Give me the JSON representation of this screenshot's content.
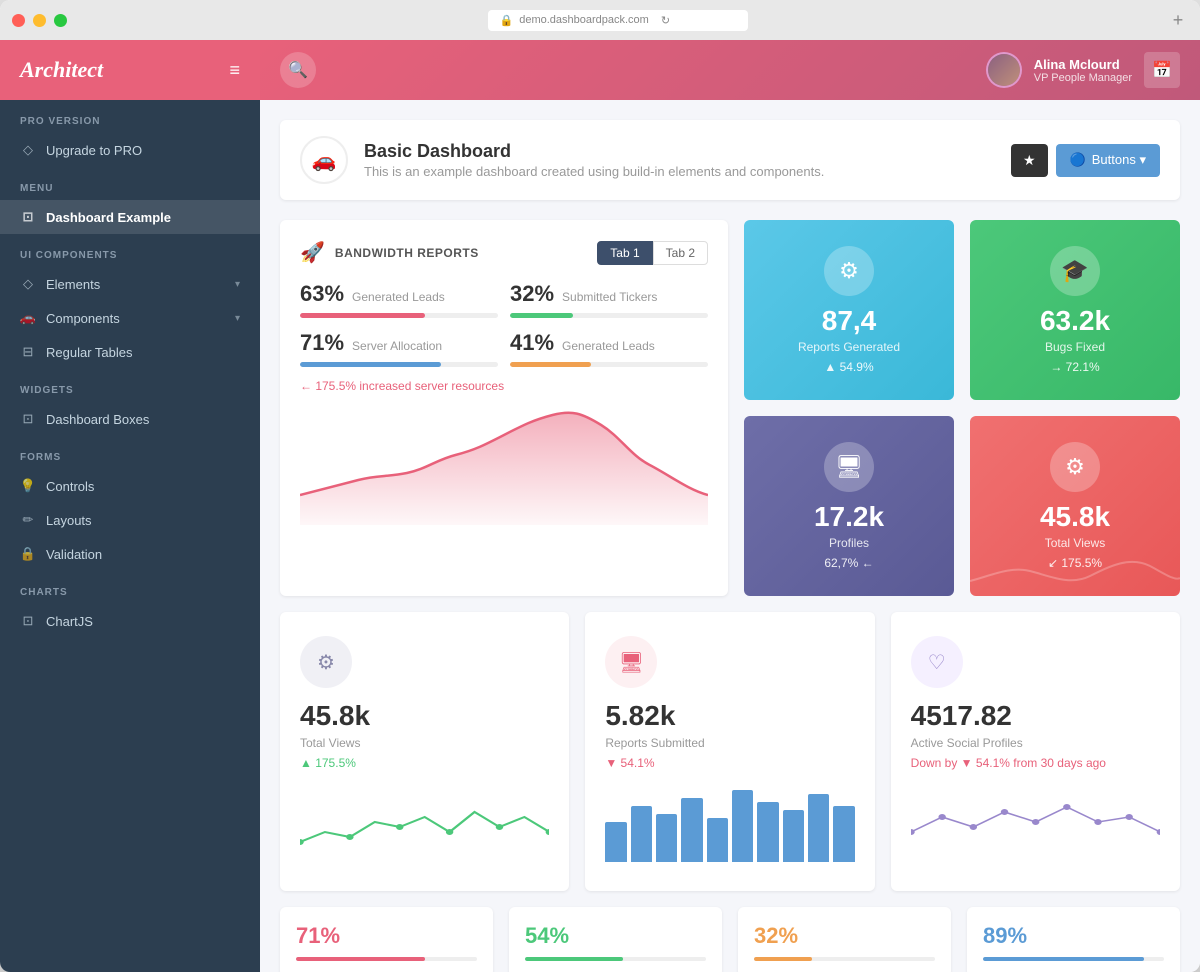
{
  "window": {
    "url": "demo.dashboardpack.com"
  },
  "brand": {
    "name": "Architect",
    "hamburger": "≡"
  },
  "topnav": {
    "search_icon": "🔍",
    "user": {
      "name": "Alina Mclourd",
      "role": "VP People Manager"
    },
    "calendar_icon": "📅"
  },
  "page_header": {
    "icon": "🚗",
    "title": "Basic Dashboard",
    "subtitle": "This is an example dashboard created using build-in elements and components.",
    "star_label": "★",
    "buttons_label": "Buttons ▾"
  },
  "sidebar": {
    "pro_section": "PRO VERSION",
    "upgrade_label": "Upgrade to PRO",
    "menu_section": "MENU",
    "menu_items": [
      {
        "label": "Dashboard Example",
        "icon": "⊡",
        "active": true
      }
    ],
    "ui_section": "UI COMPONENTS",
    "ui_items": [
      {
        "label": "Elements",
        "icon": "◇",
        "has_chevron": true
      },
      {
        "label": "Components",
        "icon": "🚗",
        "has_chevron": true
      },
      {
        "label": "Regular Tables",
        "icon": "⊟",
        "has_chevron": false
      }
    ],
    "widgets_section": "WIDGETS",
    "widgets_items": [
      {
        "label": "Dashboard Boxes",
        "icon": "⊡",
        "has_chevron": false
      }
    ],
    "forms_section": "FORMS",
    "forms_items": [
      {
        "label": "Controls",
        "icon": "💡",
        "has_chevron": false
      },
      {
        "label": "Layouts",
        "icon": "✏️",
        "has_chevron": false
      },
      {
        "label": "Validation",
        "icon": "🔒",
        "has_chevron": false
      }
    ],
    "charts_section": "CHARTS",
    "charts_items": [
      {
        "label": "ChartJS",
        "icon": "⊡",
        "has_chevron": false
      }
    ]
  },
  "bandwidth": {
    "icon": "🚀",
    "title": "BANDWIDTH REPORTS",
    "tab1": "Tab 1",
    "tab2": "Tab 2",
    "stats": [
      {
        "pct": "63%",
        "label": "Generated Leads",
        "fill": "#e8617a",
        "width": "63"
      },
      {
        "pct": "32%",
        "label": "Submitted Tickers",
        "fill": "#4cc87a",
        "width": "32"
      },
      {
        "pct": "71%",
        "label": "Server Allocation",
        "fill": "#5b9bd5",
        "width": "71"
      },
      {
        "pct": "41%",
        "label": "Generated Leads",
        "fill": "#f0a050",
        "width": "41"
      }
    ],
    "alert": "← 175.5% increased server resources"
  },
  "stat_boxes": [
    {
      "icon": "⚙",
      "value": "87,4",
      "label": "Reports Generated",
      "change": "▲ 54.9%",
      "color_class": "box-cyan"
    },
    {
      "icon": "🖥",
      "value": "17.2k",
      "label": "Profiles",
      "change": "62,7% ←",
      "color_class": "box-purple"
    },
    {
      "icon": "🎓",
      "value": "63.2k",
      "label": "Bugs Fixed",
      "change": "→ 72.1%",
      "color_class": "box-green"
    },
    {
      "icon": "⚙",
      "value": "45.8k",
      "label": "Total Views",
      "change": "↙ 175.5%",
      "color_class": "box-red"
    }
  ],
  "bottom_cards": [
    {
      "icon": "⚙",
      "icon_class": "icon-gray",
      "value": "45.8k",
      "label": "Total Views",
      "change": "▲ 175.5%",
      "change_class": "change-up",
      "chart_type": "sparkline_green"
    },
    {
      "icon": "🖥",
      "icon_class": "icon-pink",
      "value": "5.82k",
      "label": "Reports Submitted",
      "change": "▼ 54.1%",
      "change_class": "change-down",
      "chart_type": "bar_blue"
    },
    {
      "icon": "♡",
      "icon_class": "icon-lavender",
      "value": "4517.82",
      "label": "Active Social Profiles",
      "change": "Down by ▼ 54.1% from 30 days ago",
      "change_class": "change-down",
      "chart_type": "sparkline_purple"
    }
  ],
  "progress_cards": [
    {
      "pct": "71%",
      "color": "#e8617a",
      "color_class": "pct-red"
    },
    {
      "pct": "54%",
      "color": "#4cc87a",
      "color_class": "pct-green"
    },
    {
      "pct": "32%",
      "color": "#f0a050",
      "color_class": "pct-orange"
    },
    {
      "pct": "89%",
      "color": "#5b9bd5",
      "color_class": "pct-blue"
    }
  ]
}
